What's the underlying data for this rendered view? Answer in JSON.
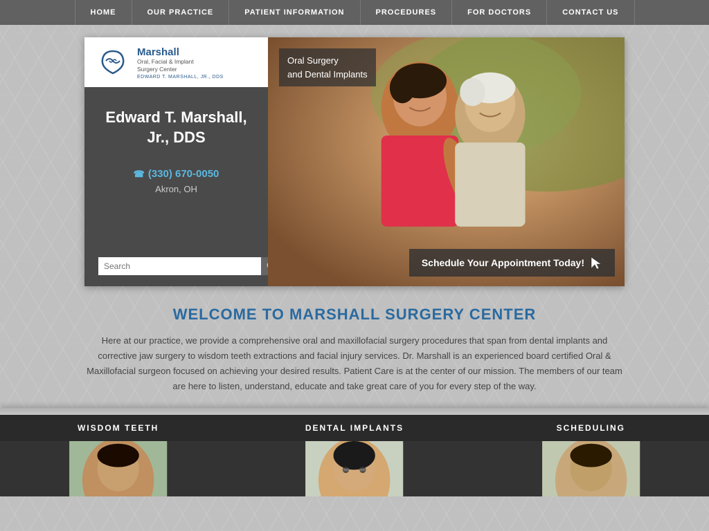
{
  "nav": {
    "items": [
      {
        "label": "HOME",
        "id": "home"
      },
      {
        "label": "OUR PRACTICE",
        "id": "our-practice"
      },
      {
        "label": "PATIENT INFORMATION",
        "id": "patient-information"
      },
      {
        "label": "PROCEDURES",
        "id": "procedures"
      },
      {
        "label": "FOR DOCTORS",
        "id": "for-doctors"
      },
      {
        "label": "CONTACT US",
        "id": "contact-us"
      }
    ]
  },
  "logo": {
    "name": "Marshall",
    "subtitle_line1": "Oral, Facial & Implant",
    "subtitle_line2": "Surgery Center",
    "dr_name": "EDWARD T. MARSHALL, JR., DDS"
  },
  "hero": {
    "doctor_name": "Edward T. Marshall, Jr., DDS",
    "phone": "(330) 670-0050",
    "city": "Akron, OH",
    "overlay_text_line1": "Oral Surgery",
    "overlay_text_line2": "and Dental Implants",
    "schedule_btn": "Schedule Your Appointment Today!",
    "search_placeholder": "Search"
  },
  "welcome": {
    "title": "WELCOME TO MARSHALL SURGERY CENTER",
    "body": "Here at our practice, we provide a comprehensive oral and maxillofacial surgery procedures that span from dental implants and corrective jaw surgery to wisdom teeth extractions and facial injury services. Dr. Marshall is an experienced board certified Oral & Maxillofacial surgeon focused on achieving your desired results. Patient Care is at the center of our mission. The members of our team are here to listen, understand, educate and take great care of you for every step of the way."
  },
  "bottom_cards": [
    {
      "label": "WISDOM TEETH",
      "id": "wisdom-teeth"
    },
    {
      "label": "DENTAL IMPLANTS",
      "id": "dental-implants"
    },
    {
      "label": "SCHEDULING",
      "id": "scheduling"
    }
  ]
}
